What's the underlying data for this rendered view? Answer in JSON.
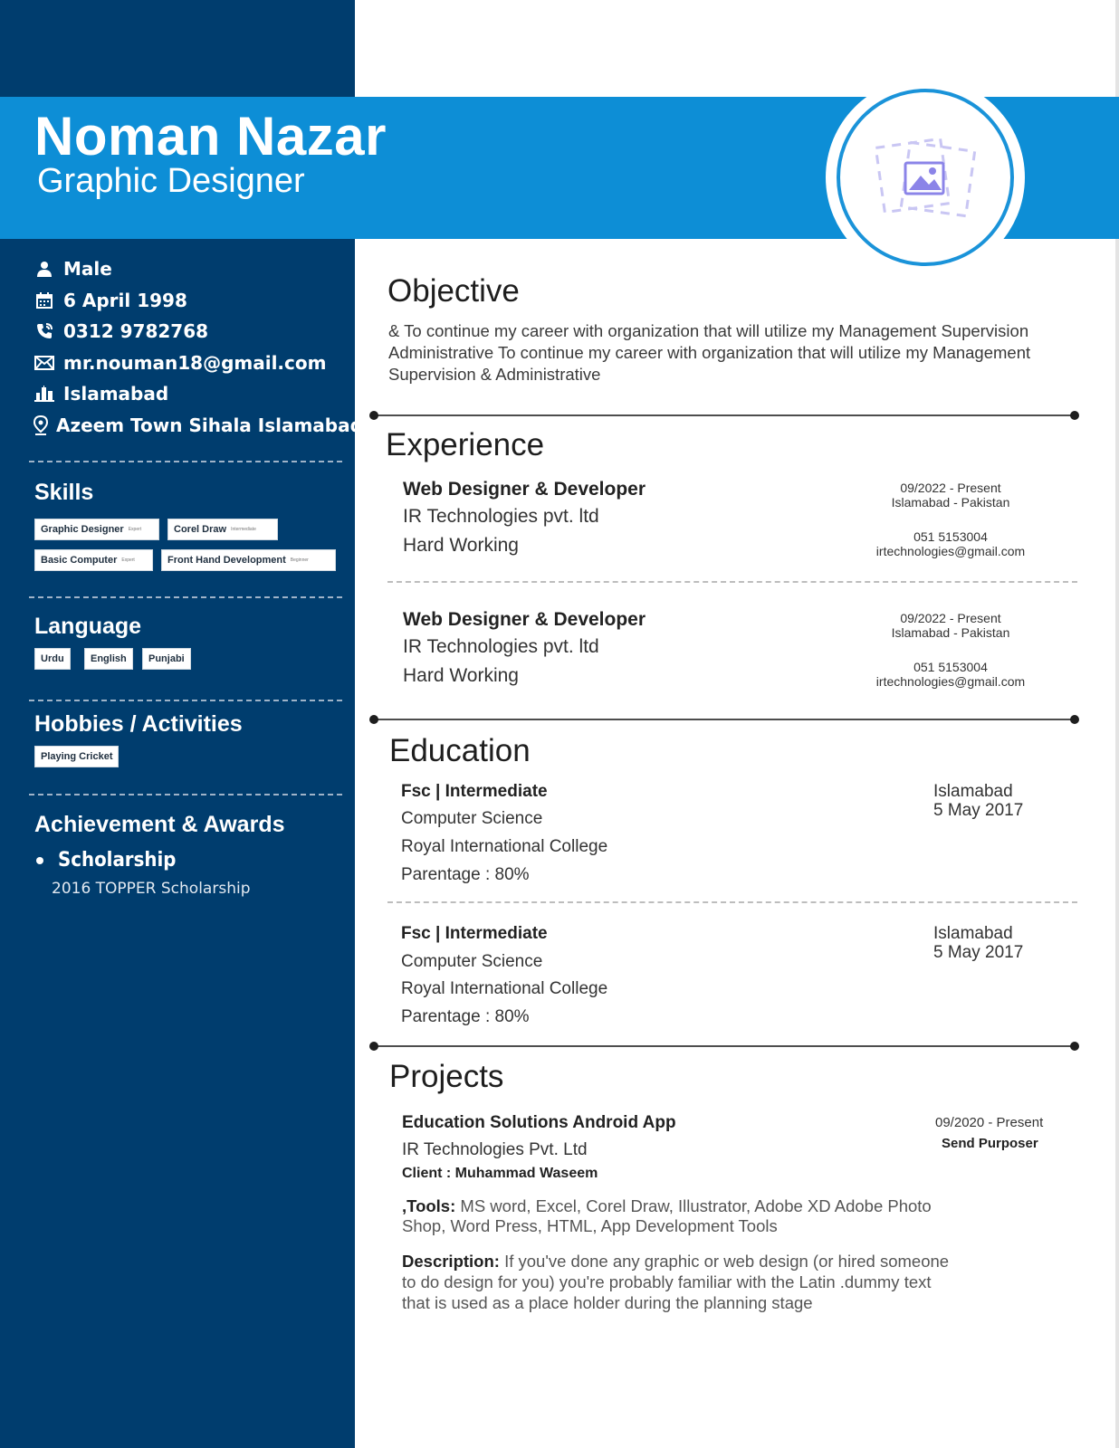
{
  "header": {
    "name": "Noman Nazar",
    "title": "Graphic Designer",
    "photo_icon": "image-placeholder-icon"
  },
  "contact": [
    {
      "icon": "user-icon",
      "text": "Male"
    },
    {
      "icon": "calendar-icon",
      "text": "6 April 1998"
    },
    {
      "icon": "phone-icon",
      "text": "0312 9782768"
    },
    {
      "icon": "mail-icon",
      "text": "mr.nouman18@gmail.com"
    },
    {
      "icon": "city-icon",
      "text": "Islamabad"
    },
    {
      "icon": "location-pin-icon",
      "text": "Azeem Town Sihala Islamabad"
    }
  ],
  "skills": {
    "heading": "Skills",
    "items": [
      {
        "name": "Graphic Designer",
        "level": "Expert"
      },
      {
        "name": "Corel Draw",
        "level": "Intermediate"
      },
      {
        "name": "Basic Computer",
        "level": "Expert"
      },
      {
        "name": "Front Hand Development",
        "level": "Beginner"
      }
    ]
  },
  "language": {
    "heading": "Language",
    "items": [
      "Urdu",
      "English",
      "Punjabi"
    ]
  },
  "hobbies": {
    "heading": "Hobbies / Activities",
    "items": [
      "Playing Cricket"
    ]
  },
  "achievements": {
    "heading": "Achievement & Awards",
    "items": [
      {
        "title": "Scholarship",
        "detail": "2016 TOPPER Scholarship"
      }
    ]
  },
  "objective": {
    "heading": "Objective",
    "text": "& To continue my career with organization that will utilize my Management Supervision Administrative To continue my career with organization that will utilize my Management Supervision & Administrative"
  },
  "experience": {
    "heading": "Experience",
    "items": [
      {
        "role": "Web Designer & Developer",
        "company": "IR Technologies pvt. ltd",
        "trait": "Hard Working",
        "dates": "09/2022 - Present",
        "location": "Islamabad - Pakistan",
        "phone": "051 5153004",
        "email": "irtechnologies@gmail.com"
      },
      {
        "role": "Web Designer & Developer",
        "company": "IR Technologies pvt. ltd",
        "trait": "Hard Working",
        "dates": "09/2022 - Present",
        "location": "Islamabad - Pakistan",
        "phone": "051 5153004",
        "email": "irtechnologies@gmail.com"
      }
    ]
  },
  "education": {
    "heading": "Education",
    "items": [
      {
        "degree": "Fsc | Intermediate",
        "field": "Computer Science",
        "school": "Royal International College",
        "grade": "Parentage : 80%",
        "city": "Islamabad",
        "date": "5 May 2017"
      },
      {
        "degree": "Fsc | Intermediate",
        "field": "Computer Science",
        "school": "Royal International College",
        "grade": "Parentage : 80%",
        "city": "Islamabad",
        "date": "5 May 2017"
      }
    ]
  },
  "projects": {
    "heading": "Projects",
    "items": [
      {
        "title": "Education Solutions Android App",
        "company": "IR Technologies Pvt. Ltd",
        "client": "Client : Muhammad Waseem",
        "dates": "09/2020 - Present",
        "role": "Send Purposer",
        "tools_label": ",Tools:",
        "tools": "MS word, Excel, Corel Draw, Illustrator, Adobe XD Adobe Photo Shop, Word Press, HTML, App Development Tools",
        "description_label": "Description:",
        "description": "If you've done any graphic or web design (or hired someone to do design for you) you're probably familiar with the Latin .dummy text that is used as a place holder during the planning stage"
      }
    ]
  },
  "colors": {
    "sidebar": "#003d6e",
    "banner": "#0d8ed6",
    "ring": "#1a93d9"
  }
}
